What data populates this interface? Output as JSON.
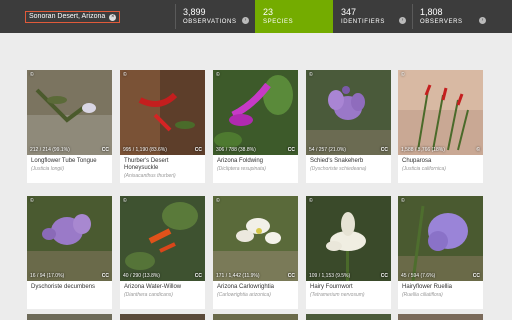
{
  "header": {
    "place": "Sonoran Desert, Arizona",
    "stats": [
      {
        "number": "3,899",
        "label": "OBSERVATIONS"
      },
      {
        "number": "23",
        "label": "SPECIES"
      },
      {
        "number": "347",
        "label": "IDENTIFIERS"
      },
      {
        "number": "1,808",
        "label": "OBSERVERS"
      }
    ],
    "active_color": "#74ac00"
  },
  "species": [
    {
      "common": "Longflower Tube Tongue",
      "scientific": "(Justicia longii)",
      "caption": "212 / 214 (99.1%)",
      "license": "CC"
    },
    {
      "common": "Thurber's Desert Honeysuckle",
      "scientific": "(Anisacanthus thurberi)",
      "caption": "995 / 1,190 (83.6%)",
      "license": "CC"
    },
    {
      "common": "Arizona Foldwing",
      "scientific": "(Dicliptera resupinata)",
      "caption": "306 / 788 (38.8%)",
      "license": "CC"
    },
    {
      "common": "Schied's Snakeherb",
      "scientific": "(Dyschoriste schiedeana)",
      "caption": "54 / 257 (21.0%)",
      "license": "CC"
    },
    {
      "common": "Chuparosa",
      "scientific": "(Justicia californica)",
      "caption": "1,588 / 8,766 (18%)",
      "license": "©"
    },
    {
      "common": "Dyschoriste decumbens",
      "scientific": "",
      "caption": "16 / 94 (17.0%)",
      "license": "CC"
    },
    {
      "common": "Arizona Water-Willow",
      "scientific": "(Dianthera candicans)",
      "caption": "40 / 290 (13.8%)",
      "license": "CC"
    },
    {
      "common": "Arizona Carlowrightia",
      "scientific": "(Carlowrightia arizonica)",
      "caption": "171 / 1,442 (11.9%)",
      "license": "CC"
    },
    {
      "common": "Hairy Fournwort",
      "scientific": "(Tetramerium nervosum)",
      "caption": "109 / 1,153 (9.5%)",
      "license": "CC"
    },
    {
      "common": "Hairyflower Ruellia",
      "scientific": "(Ruellia ciliatiflora)",
      "caption": "45 / 594 (7.6%)",
      "license": "CC"
    }
  ]
}
